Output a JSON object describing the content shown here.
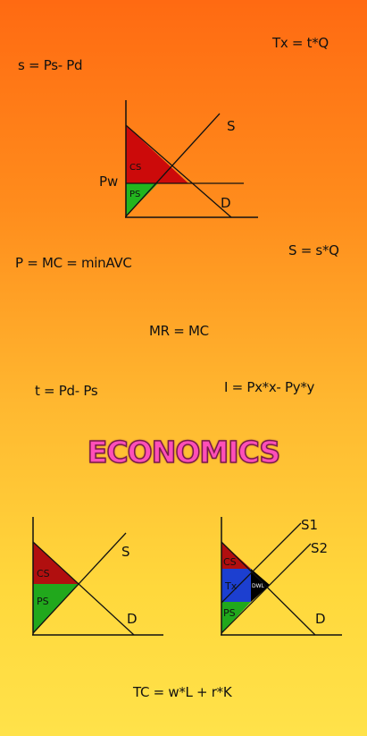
{
  "formulas": {
    "tax_revenue": "Tx = t*Q",
    "subsidy_price": "s = Ps- Pd",
    "competitive_rule": "P = MC = minAVC",
    "subsidy_total": "S = s*Q",
    "profit_rule": "MR = MC",
    "tax_price": "t = Pd- Ps",
    "income": "I = Px*x- Py*y",
    "total_cost": "TC = w*L + r*K"
  },
  "title": "ECONOMICS",
  "graph_top": {
    "supply_label": "S",
    "demand_label": "D",
    "price_label": "Pw",
    "cs_label": "CS",
    "ps_label": "PS"
  },
  "graph_left": {
    "supply_label": "S",
    "demand_label": "D",
    "cs_label": "CS",
    "ps_label": "PS"
  },
  "graph_right": {
    "supply1_label": "S1",
    "supply2_label": "S2",
    "demand_label": "D",
    "cs_label": "CS",
    "tax_label": "Tx",
    "dwl_label": "DWL",
    "ps_label": "PS"
  },
  "colors": {
    "consumer_surplus": "#cc0a0a",
    "producer_surplus": "#22b61e",
    "tax_revenue": "#1c3fd0",
    "deadweight_loss": "#000000",
    "title_pink": "#ff4fb8"
  }
}
